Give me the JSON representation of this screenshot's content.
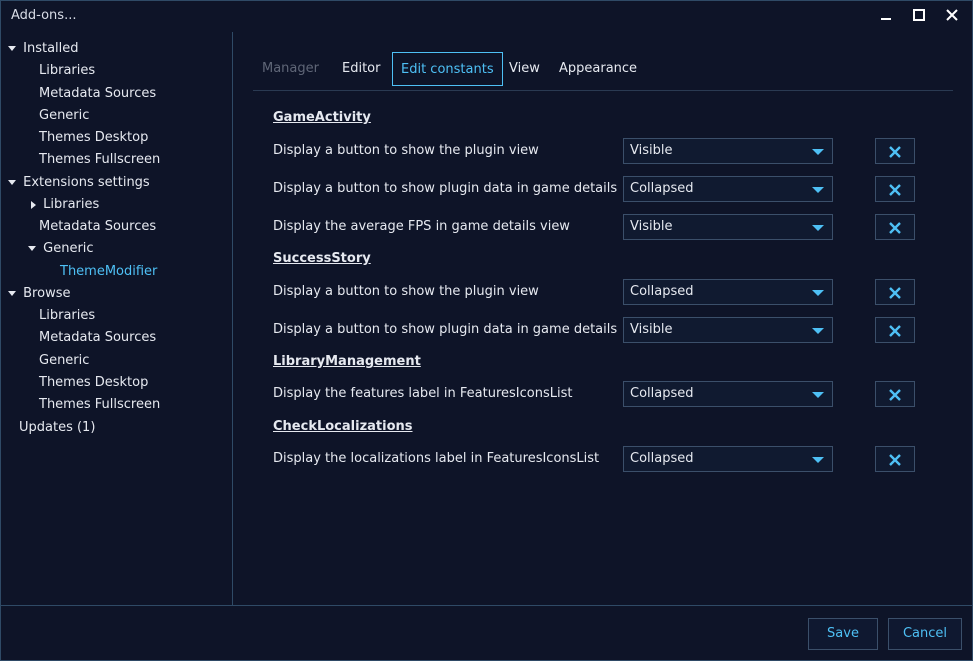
{
  "window": {
    "title": "Add-ons..."
  },
  "sidebar": {
    "installed": {
      "label": "Installed",
      "items": [
        "Libraries",
        "Metadata Sources",
        "Generic",
        "Themes Desktop",
        "Themes Fullscreen"
      ]
    },
    "extensions": {
      "label": "Extensions settings",
      "libraries": "Libraries",
      "metadata": "Metadata Sources",
      "generic": "Generic",
      "theme_modifier": "ThemeModifier"
    },
    "browse": {
      "label": "Browse",
      "items": [
        "Libraries",
        "Metadata Sources",
        "Generic",
        "Themes Desktop",
        "Themes Fullscreen"
      ]
    },
    "updates": "Updates (1)"
  },
  "tabs": [
    "Manager",
    "Editor",
    "Edit constants",
    "View",
    "Appearance"
  ],
  "sections": [
    {
      "title": "GameActivity",
      "rows": [
        {
          "label": "Display a button to show the plugin view",
          "value": "Visible"
        },
        {
          "label": "Display a button to show plugin data in game details",
          "value": "Collapsed"
        },
        {
          "label": "Display the average FPS in game details view",
          "value": "Visible"
        }
      ]
    },
    {
      "title": "SuccessStory",
      "rows": [
        {
          "label": "Display a button to show the plugin view",
          "value": "Collapsed"
        },
        {
          "label": "Display a button to show plugin data in game details",
          "value": "Visible"
        }
      ]
    },
    {
      "title": "LibraryManagement",
      "rows": [
        {
          "label": "Display the features label in FeaturesIconsList",
          "value": "Collapsed"
        }
      ]
    },
    {
      "title": "CheckLocalizations",
      "rows": [
        {
          "label": "Display the localizations label in FeaturesIconsList",
          "value": "Collapsed"
        }
      ]
    }
  ],
  "footer": {
    "save": "Save",
    "cancel": "Cancel"
  },
  "colors": {
    "accent": "#4ec0f5",
    "background": "#0e1428",
    "border": "#2f4a66"
  }
}
